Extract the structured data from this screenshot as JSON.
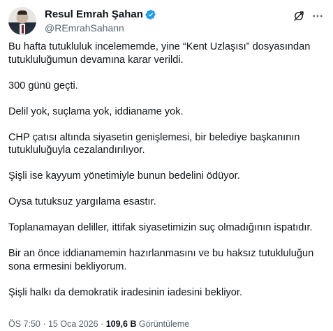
{
  "author": {
    "display_name": "Resul Emrah Şahan",
    "handle": "@REmrahSahann",
    "verified_color": "#1d9bf0"
  },
  "icons": {
    "grok": "grok-icon",
    "more": "more-icon",
    "verified": "verified-badge-icon"
  },
  "tweet": {
    "paragraphs": [
      "Bu hafta tutukluluk incelememde, yine “Kent Uzlaşısı” dosyasından tutukluluğumun devamına karar verildi.",
      "300 günü geçti.",
      "Delil yok, suçlama yok, iddianame yok.",
      "CHP çatısı altında siyasetin genişlemesi, bir belediye başkanının tutukluluğuyla cezalandırılıyor.",
      "Şişli ise kayyum yönetimiyle bunun bedelini ödüyor.",
      "Oysa tutuksuz yargılama esastır.",
      "Toplanamayan deliller, ittifak siyasetimizin suç olmadığının ispatıdır.",
      "Bir an önce iddianamemin hazırlanmasını ve bu haksız tutukluluğun sona ermesini bekliyorum.",
      "Şişli halkı da demokratik iradesinin iadesini bekliyor."
    ]
  },
  "meta": {
    "time": "ÖS 7:50",
    "separator": " · ",
    "date": "15 Oca 2026",
    "views_count": "109,6 B",
    "views_label": " Görüntüleme"
  }
}
